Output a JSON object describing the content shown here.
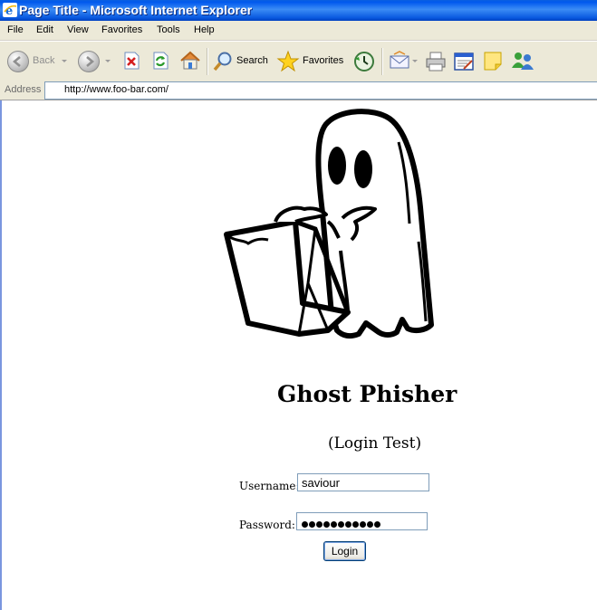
{
  "window": {
    "title": "Page Title - Microsoft Internet Explorer"
  },
  "menu": [
    "File",
    "Edit",
    "View",
    "Favorites",
    "Tools",
    "Help"
  ],
  "toolbar": {
    "back_label": "Back",
    "search_label": "Search",
    "favorites_label": "Favorites"
  },
  "address": {
    "label": "Address",
    "url": "http://www.foo-bar.com/"
  },
  "page": {
    "heading": "Ghost Phisher",
    "subheading": "(Login Test)",
    "username_label": "Username:",
    "username_value": "saviour",
    "password_label": "Password:",
    "password_length": 11,
    "login_button": "Login"
  },
  "colors": {
    "titlebar": "#0058ee",
    "chrome": "#ece9d8",
    "field_border": "#7f9db9"
  }
}
